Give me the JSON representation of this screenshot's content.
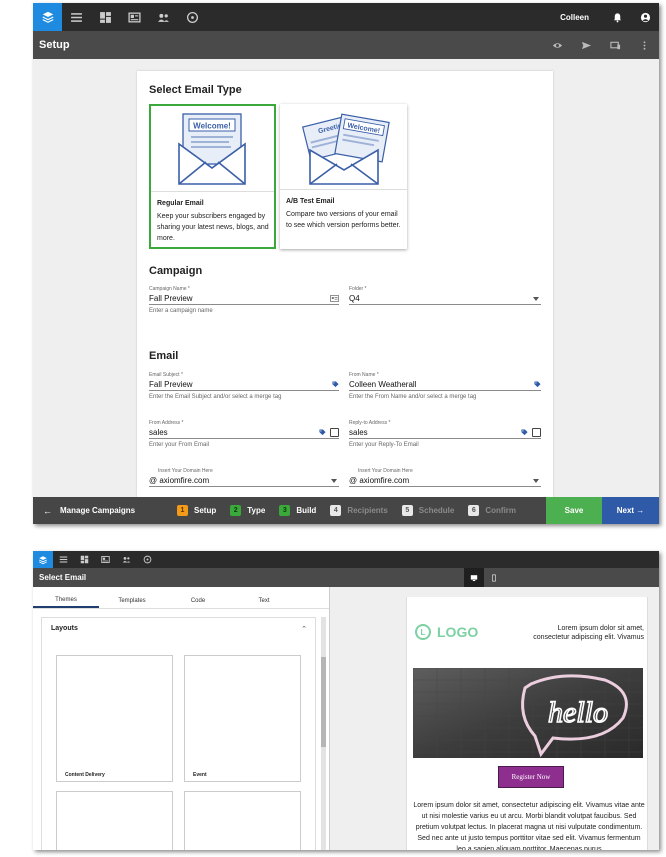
{
  "shot1": {
    "user_name": "Colleen",
    "page_title": "Setup",
    "select_type_heading": "Select Email Type",
    "email_types": [
      {
        "title": "Regular Email",
        "desc": "Keep your subscribers engaged by sharing your latest news, blogs, and more.",
        "selected": true,
        "illu_text": "Welcome!"
      },
      {
        "title": "A/B Test Email",
        "desc": "Compare two versions of your email to see which version performs better.",
        "selected": false,
        "illu_text_a": "Greeting",
        "illu_text_b": "Welcome!"
      }
    ],
    "campaign_heading": "Campaign",
    "campaign_name": {
      "label": "Campaign Name *",
      "value": "Fall Preview",
      "help": "Enter a campaign name"
    },
    "folder": {
      "label": "Folder *",
      "value": "Q4"
    },
    "email_heading": "Email",
    "email_subject": {
      "label": "Email Subject *",
      "value": "Fall Preview",
      "help": "Enter the Email Subject and/or select a merge tag"
    },
    "from_name": {
      "label": "From Name *",
      "value": "Colleen Weatherall",
      "help": "Enter the From Name and/or select a merge tag"
    },
    "from_address": {
      "label": "From Address *",
      "value": "sales",
      "help": "Enter your From Email"
    },
    "reply_to": {
      "label": "Reply-to Address *",
      "value": "sales",
      "help": "Enter your Reply-To Email"
    },
    "domain_left": {
      "label": "Insert Your Domain Here",
      "value": "@ axiomfire.com"
    },
    "domain_right": {
      "label": "Insert Your Domain Here",
      "value": "@ axiomfire.com"
    },
    "manage_campaigns": "Manage Campaigns",
    "steps": [
      {
        "num": "1",
        "label": "Setup",
        "state": "current"
      },
      {
        "num": "2",
        "label": "Type",
        "state": "done"
      },
      {
        "num": "3",
        "label": "Build",
        "state": "done"
      },
      {
        "num": "4",
        "label": "Recipients",
        "state": "todo"
      },
      {
        "num": "5",
        "label": "Schedule",
        "state": "todo"
      },
      {
        "num": "6",
        "label": "Confirm",
        "state": "todo"
      }
    ],
    "save_label": "Save",
    "next_label": "Next →"
  },
  "shot2": {
    "page_title": "Select Email",
    "tabs": [
      "Themes",
      "Templates",
      "Code",
      "Text"
    ],
    "layouts_heading": "Layouts",
    "tiles": [
      "Content Delivery",
      "Event",
      "",
      ""
    ],
    "email_preview": {
      "logo_letter": "L",
      "logo_text": "LOGO",
      "header_text": "Lorem ipsum dolor sit amet, consectetur adipiscing elit. Vivamus",
      "hero_text": "hello",
      "button": "Register Now",
      "body_text": "Lorem ipsum dolor sit amet, consectetur adipiscing elit. Vivamus vitae ante ut nisi molestie varius eu ut arcu. Morbi blandit volutpat faucibus. Sed pretium volutpat lectus. In placerat magna ut nisi vulputate condimentum. Sed nec ante ut justo tempus porttitor vitae sed elit. Vivamus fermentum leo a sapien aliquam porttitor. Maecenas purus"
    }
  },
  "colors": {
    "accent": "#1e8be0",
    "success": "#4caf50",
    "next": "#2f5aa8",
    "button_purple": "#8e2f8f",
    "logo_green": "#7cd1a3"
  }
}
